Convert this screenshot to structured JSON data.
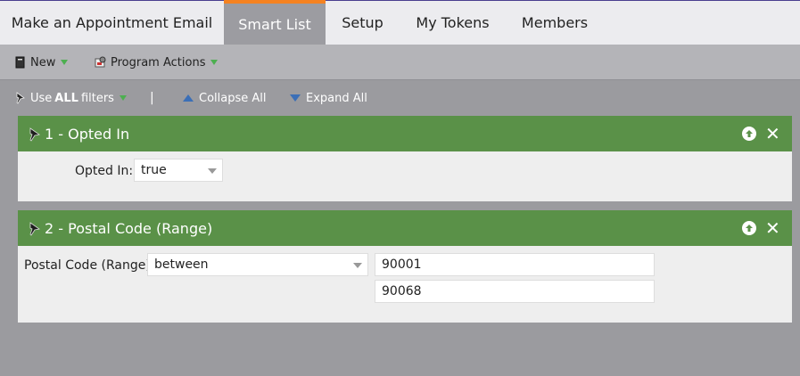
{
  "tabs": [
    {
      "label": "Make an Appointment Email"
    },
    {
      "label": "Smart List"
    },
    {
      "label": "Setup"
    },
    {
      "label": "My Tokens"
    },
    {
      "label": "Members"
    }
  ],
  "active_tab": "Smart List",
  "toolbar": {
    "new_label": "New",
    "program_actions_label": "Program Actions"
  },
  "filterbar": {
    "use_prefix": "Use",
    "use_bold": "ALL",
    "use_suffix": "filters",
    "separator": "|",
    "collapse_all": "Collapse All",
    "expand_all": "Expand All"
  },
  "filters": [
    {
      "title": "1 - Opted In",
      "field_label": "Opted In:",
      "operator": "true"
    },
    {
      "title": "2 - Postal Code (Range)",
      "field_label": "Postal Code (Range):",
      "operator": "between",
      "value_from": "90001",
      "value_to": "90068"
    }
  ],
  "colors": {
    "accent_orange": "#f58220",
    "filter_header_green": "#5a9148",
    "caret_green": "#4caf50",
    "link_blue": "#3b6fb7"
  },
  "icons": {
    "new": "document-icon",
    "program_actions": "gear-box-icon",
    "use_filters": "pin-icon",
    "collapse": "triangle-up-icon",
    "expand": "triangle-down-icon",
    "filter_pin": "pin-icon",
    "move_up": "arrow-up-circle-icon",
    "remove": "close-icon"
  }
}
